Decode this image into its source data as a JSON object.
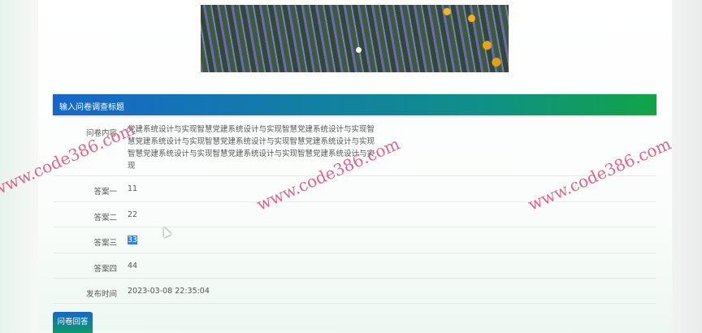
{
  "header": {
    "title": "输入问卷调查标题"
  },
  "fields": [
    {
      "label": "问卷内容",
      "value": "党建系统设计与实现智慧党建系统设计与实现智慧党建系统设计与实现智慧党建系统设计与实现智慧党建系统设计与实现智慧党建系统设计与实现智慧党建系统设计与实现智慧党建系统设计与实现智慧党建系统设计与实现"
    },
    {
      "label": "答案一",
      "value": "11"
    },
    {
      "label": "答案二",
      "value": "22"
    },
    {
      "label": "答案三",
      "value": "33"
    },
    {
      "label": "答案四",
      "value": "44"
    },
    {
      "label": "发布时间",
      "value": "2023-03-08 22:35:04"
    }
  ],
  "button": {
    "label": "问卷回答"
  },
  "watermark": "www.code386.com",
  "colors": {
    "header_start": "#1667c9",
    "header_end": "#11a446",
    "selection": "#3b80de"
  }
}
